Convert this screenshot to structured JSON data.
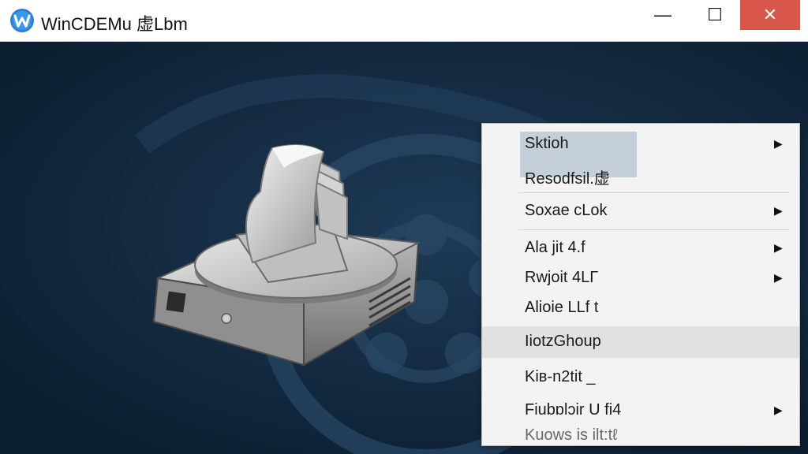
{
  "window": {
    "title": "WinCDEMu 虚Lbm",
    "minimize_glyph": "—",
    "maximize_glyph": "☐",
    "close_glyph": "✕"
  },
  "icons": {
    "app": "wincdemu-logo-icon",
    "drive": "virtual-drive-icon",
    "submenu": "chevron-right-icon"
  },
  "colors": {
    "background": "#0e2238",
    "close_button": "#d9574a",
    "menu_bg": "#f3f3f3",
    "menu_hover": "#e1e1e1"
  },
  "context_menu": {
    "items": [
      {
        "label": "Sktioh",
        "submenu": true
      },
      {
        "label": "Resodfsil.虚",
        "submenu": false
      },
      {
        "label": "Soxae cLok",
        "submenu": true
      },
      {
        "label": "Ala jit 4.f",
        "submenu": true
      },
      {
        "label": "Rwjoit 4LΓ",
        "submenu": true
      },
      {
        "label": "Alioie LLf t",
        "submenu": false
      },
      {
        "label": "IiotzGhoup",
        "submenu": false
      },
      {
        "label": "Kiʙ-n2tit _",
        "submenu": false
      },
      {
        "label": "Fiubɒlɔir U fi4",
        "submenu": true
      },
      {
        "label": "Kuows is ilt:tℓ",
        "submenu": false
      }
    ]
  }
}
